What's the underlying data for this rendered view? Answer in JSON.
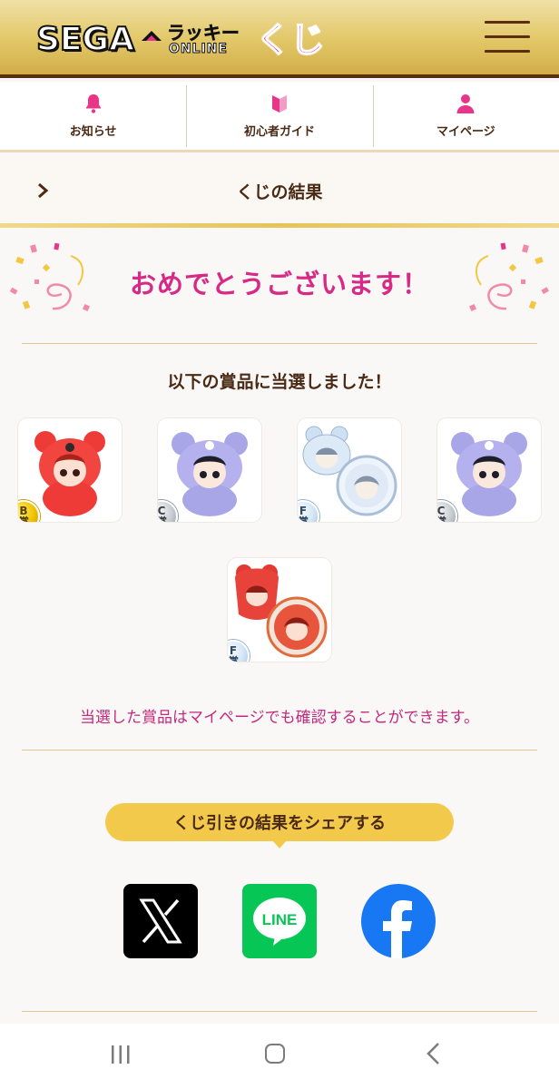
{
  "header": {
    "logo": {
      "sega": "SEGA",
      "lucky": "ラッキー",
      "online": "ONLINE",
      "kuji": "くじ"
    },
    "menu_icon": "hamburger-menu-icon"
  },
  "nav": {
    "items": [
      {
        "label": "お知らせ",
        "icon": "bell-icon"
      },
      {
        "label": "初心者ガイド",
        "icon": "beginner-mark-icon"
      },
      {
        "label": "マイページ",
        "icon": "person-icon"
      }
    ]
  },
  "section": {
    "title": "くじの結果"
  },
  "result": {
    "congrats": "おめでとうございます！",
    "won_label": "以下の賞品に当選しました！",
    "prizes": [
      {
        "grade": "B",
        "suffix": "賞",
        "item": "red-bear-plush"
      },
      {
        "grade": "C",
        "suffix": "賞",
        "item": "purple-bear-plush"
      },
      {
        "grade": "F",
        "suffix": "賞",
        "item": "blue-acrylic-badge-set"
      },
      {
        "grade": "C",
        "suffix": "賞",
        "item": "purple-bear-plush"
      },
      {
        "grade": "F",
        "suffix": "賞",
        "item": "red-acrylic-badge-set"
      }
    ],
    "mypage_note": "当選した賞品はマイページでも確認することができます。"
  },
  "share": {
    "label": "くじ引きの結果をシェアする",
    "buttons": [
      {
        "name": "X",
        "icon": "x-logo-icon",
        "color": "#000000"
      },
      {
        "name": "LINE",
        "label": "LINE",
        "icon": "line-logo-icon",
        "color": "#06C755"
      },
      {
        "name": "Facebook",
        "icon": "facebook-logo-icon",
        "color": "#1877F2"
      }
    ]
  },
  "colors": {
    "accent_pink": "#D62A86",
    "gold": "#F3C94C",
    "brown": "#4A2A14"
  }
}
